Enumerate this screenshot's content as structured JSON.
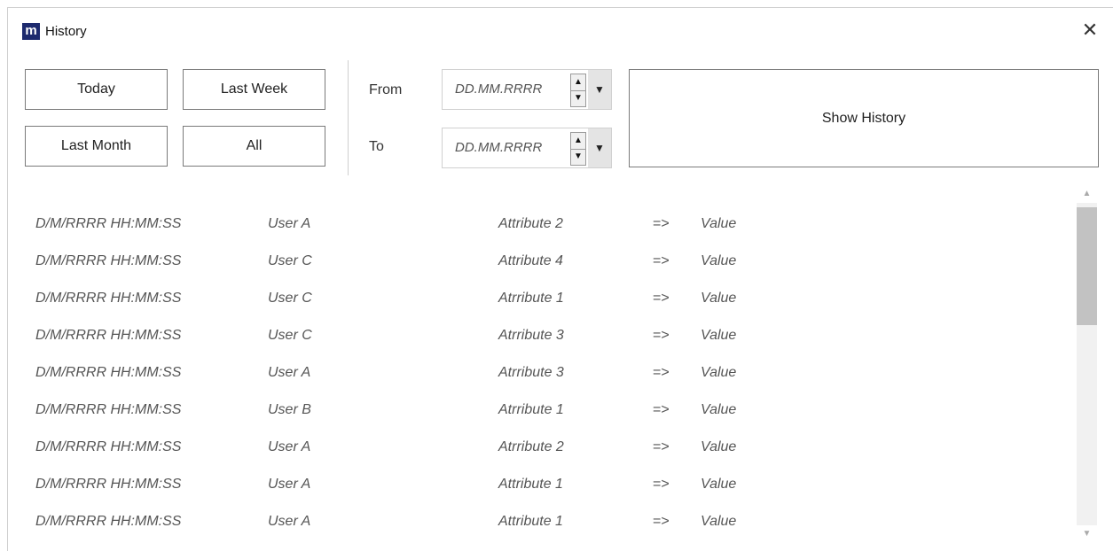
{
  "window": {
    "title": "History",
    "app_icon_letter": "m",
    "close_glyph": "✕"
  },
  "quick_filters": {
    "today": "Today",
    "last_week": "Last Week",
    "last_month": "Last Month",
    "all": "All"
  },
  "range": {
    "from_label": "From",
    "to_label": "To",
    "from_value": "DD.MM.RRRR",
    "to_value": "DD.MM.RRRR"
  },
  "show_history_label": "Show History",
  "history": [
    {
      "time": "D/M/RRRR  HH:MM:SS",
      "user": "User A",
      "attribute": "Attribute 2",
      "arrow": "=>",
      "value": "Value"
    },
    {
      "time": "D/M/RRRR  HH:MM:SS",
      "user": "User C",
      "attribute": "Attribute 4",
      "arrow": "=>",
      "value": "Value"
    },
    {
      "time": "D/M/RRRR  HH:MM:SS",
      "user": "User C",
      "attribute": "Atrribute 1",
      "arrow": "=>",
      "value": "Value"
    },
    {
      "time": "D/M/RRRR  HH:MM:SS",
      "user": "User C",
      "attribute": "Atrribute 3",
      "arrow": "=>",
      "value": "Value"
    },
    {
      "time": "D/M/RRRR  HH:MM:SS",
      "user": "User A",
      "attribute": "Atrribute 3",
      "arrow": "=>",
      "value": "Value"
    },
    {
      "time": "D/M/RRRR  HH:MM:SS",
      "user": "User B",
      "attribute": "Atrribute 1",
      "arrow": "=>",
      "value": "Value"
    },
    {
      "time": "D/M/RRRR  HH:MM:SS",
      "user": "User A",
      "attribute": "Atrribute 2",
      "arrow": "=>",
      "value": "Value"
    },
    {
      "time": "D/M/RRRR  HH:MM:SS",
      "user": "User A",
      "attribute": "Attribute 1",
      "arrow": "=>",
      "value": "Value"
    },
    {
      "time": "D/M/RRRR  HH:MM:SS",
      "user": "User A",
      "attribute": "Attribute 1",
      "arrow": "=>",
      "value": "Value"
    }
  ],
  "scrollbar": {
    "up_icon": "chevron-up-icon",
    "down_icon": "chevron-down-icon"
  }
}
